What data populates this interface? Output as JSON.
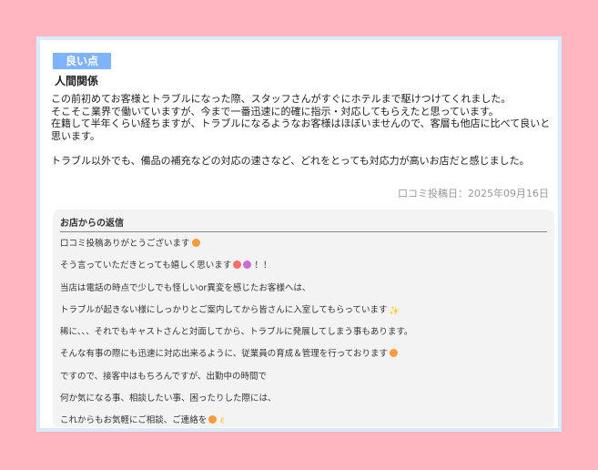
{
  "review": {
    "badge": "良い点",
    "category": "人間関係",
    "paragraph1": [
      "この前初めてお客様とトラブルになった際、スタッフさんがすぐにホテルまで駆けつけてくれました。",
      "そこそこ業界で働いていますが、今まで一番迅速に的確に指示・対応してもらえたと思っています。",
      "在籍して半年くらい経ちますが、トラブルになるようなお客様はほぼいませんので、客層も他店に比べて良いと思います。"
    ],
    "paragraph2": "トラブル以外でも、備品の補充などの対応の速さなど、どれをとっても対応力が高いお店だと感じました。",
    "posted_date": "口コミ投稿日：2025年09月16日"
  },
  "reply": {
    "title": "お店からの返信",
    "lines": [
      "口コミ投稿ありがとうございます",
      "そう言っていただきとっても嬉しく思います",
      "当店は電話の時点で少しでも怪しいor異変を感じたお客様へは、",
      "トラブルが起きない様にしっかりとご案内してから皆さんに入室してもらっています",
      "稀に、、、それでもキャストさんと対面してから、トラブルに発展してしまう事もあります。",
      "そんな有事の際にも迅速に対応出来るように、従業員の育成＆管理を行っております",
      "ですので、接客中はもちろんですが、出勤中の時間で",
      "何か気になる事、相談したい事、困ったりした際には、",
      "これからもお気軽にご相談、ご連絡を"
    ],
    "line2_suffix": "！！",
    "icons": [
      "smile-emoji-icon",
      "heart-face-emoji-icon",
      "sparkle-emoji-icon",
      "thumbs-up-emoji-icon",
      "peace-emoji-icon"
    ]
  },
  "colors": {
    "background": "#ffb6c1",
    "badge": "#7fb2ff",
    "card_border": "#d9ecff",
    "reply_bg": "#f3f3f3"
  }
}
